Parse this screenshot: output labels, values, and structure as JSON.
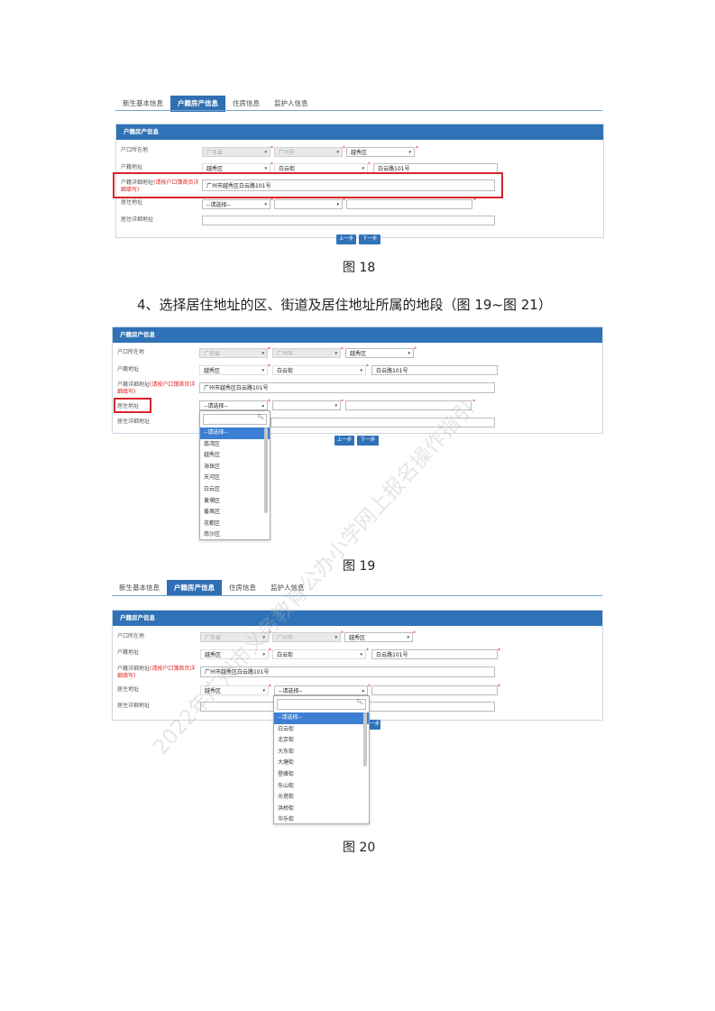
{
  "tabs": [
    "新生基本信息",
    "户籍房产信息",
    "住房信息",
    "监护人信息"
  ],
  "panel_title": "户籍房产信息",
  "labels": {
    "hukou_place": "户口所在地",
    "hukou_addr": "户籍地址",
    "hukou_detail": "户籍详细地址",
    "hukou_detail_note": "(请按户口簿首页详细填写)",
    "residence": "居住地址",
    "residence_detail": "居住详细地址"
  },
  "values": {
    "province": "广东省",
    "city": "广州市",
    "district": "越秀区",
    "street": "白云街",
    "road": "白云路101号",
    "detail": "广州市越秀区白云路101号",
    "please_select": "--请选择--"
  },
  "buttons": {
    "prev": "上一步",
    "next": "下一步"
  },
  "captions": {
    "fig18": "图 18",
    "fig19": "图 19",
    "fig20": "图 20"
  },
  "heading": "4、选择居住地址的区、街道及居住地址所属的地段（图 19~图 21）",
  "dropdown_districts": [
    "--请选择--",
    "荔湾区",
    "越秀区",
    "海珠区",
    "天河区",
    "白云区",
    "黄埔区",
    "番禺区",
    "花都区",
    "南沙区"
  ],
  "dropdown_streets": [
    "--请选择--",
    "白云街",
    "北京街",
    "大东街",
    "大塘街",
    "登峰街",
    "东山街",
    "光塔街",
    "洪桥街",
    "华乐街"
  ],
  "watermark": "2022年广州市义务教育公办小学网上报名操作指引"
}
